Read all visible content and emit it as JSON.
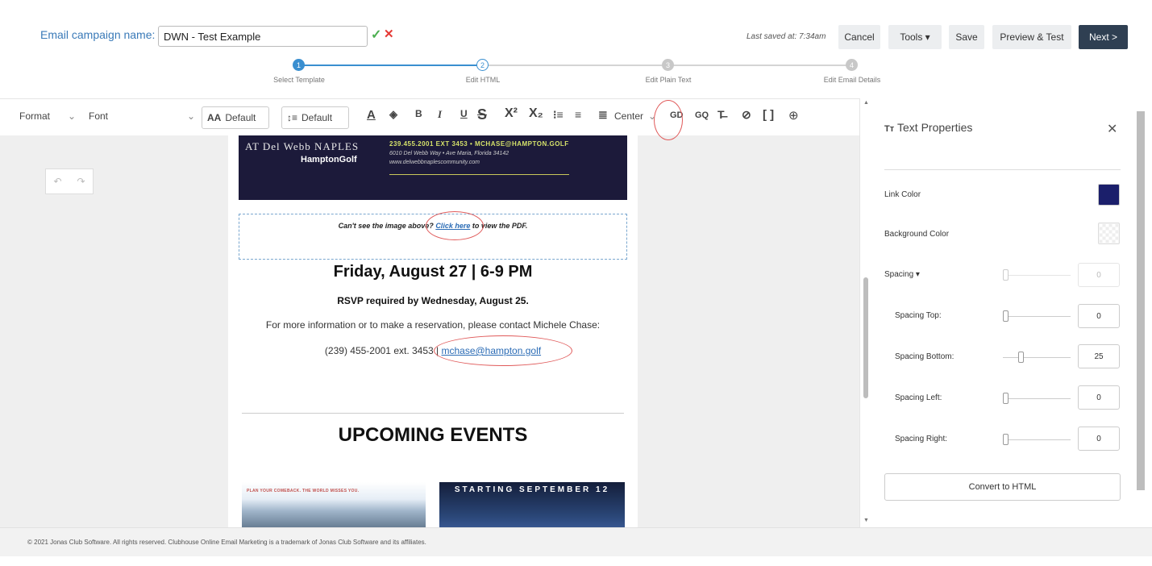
{
  "header": {
    "campaign_label": "Email campaign name:",
    "campaign_value": "DWN - Test Example",
    "last_saved": "Last saved at: 7:34am",
    "buttons": {
      "cancel": "Cancel",
      "tools": "Tools ▾",
      "save": "Save",
      "preview": "Preview & Test",
      "next": "Next >"
    }
  },
  "steps": [
    {
      "num": "1",
      "label": "Select Template"
    },
    {
      "num": "2",
      "label": "Edit HTML"
    },
    {
      "num": "3",
      "label": "Edit Plain Text"
    },
    {
      "num": "4",
      "label": "Edit Email Details"
    }
  ],
  "toolbar": {
    "format": "Format",
    "font": "Font",
    "font_size": "Default",
    "line_height": "Default",
    "align": "Center"
  },
  "email": {
    "banner_brand": "AT Del Webb NAPLES",
    "banner_logo": "HamptonGolf",
    "banner_line1": "239.455.2001 EXT 3453 • MCHASE@HAMPTON.GOLF",
    "banner_line2": "6010 Del Webb Way • Ave Maria, Florida 34142",
    "banner_line3": "www.delwebbnaplescommunity.com",
    "cant_see_pre": "Can't see the image above?",
    "cant_see_link": "Click here",
    "cant_see_post": "to view the PDF.",
    "event_date": "Friday, August 27 | 6-9 PM",
    "rsvp": "RSVP required by Wednesday, August 25.",
    "more_info": "For more information or to make a reservation, please contact Michele Chase:",
    "phone": "(239) 455-2001 ext. 3453 |",
    "email_link": "mchase@hampton.golf",
    "upcoming": "UPCOMING EVENTS",
    "promo1": "PLAN YOUR COMEBACK. THE WORLD MISSES YOU.",
    "promo2": "STARTING SEPTEMBER 12"
  },
  "panel": {
    "title": "Text Properties",
    "link_color_label": "Link Color",
    "link_color": "#1b1f6b",
    "bg_color_label": "Background Color",
    "spacing_label": "Spacing ▾",
    "spacing_value": "0",
    "spacing_top_label": "Spacing Top:",
    "spacing_top": "0",
    "spacing_bottom_label": "Spacing Bottom:",
    "spacing_bottom": "25",
    "spacing_left_label": "Spacing Left:",
    "spacing_left": "0",
    "spacing_right_label": "Spacing Right:",
    "spacing_right": "0",
    "convert": "Convert to HTML"
  },
  "footer": {
    "text": "© 2021 Jonas Club Software. All rights reserved. Clubhouse Online Email Marketing is a trademark of Jonas Club Software and its affiliates."
  }
}
